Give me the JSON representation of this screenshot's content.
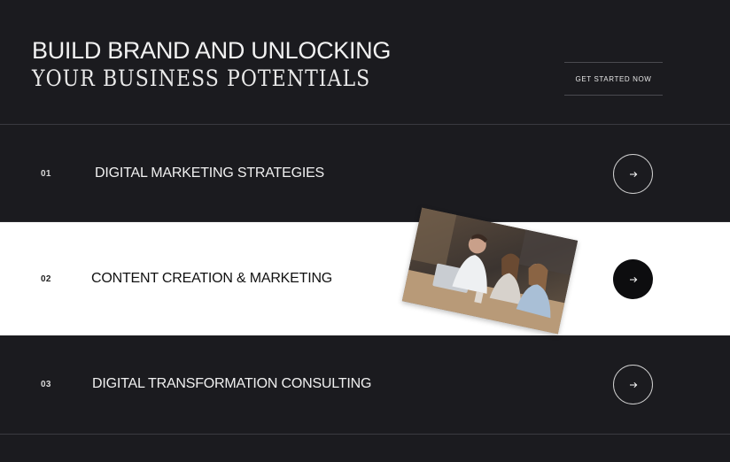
{
  "hero": {
    "title": "BUILD BRAND AND UNLOCKING",
    "subtitle": "YOUR BUSINESS POTENTIALS",
    "cta_label": "GET STARTED NOW"
  },
  "services": [
    {
      "number": "01",
      "label": "DIGITAL MARKETING STRATEGIES",
      "icon": "arrow-right-icon"
    },
    {
      "number": "02",
      "label": "CONTENT CREATION & MARKETING",
      "icon": "arrow-right-icon"
    },
    {
      "number": "03",
      "label": "DIGITAL TRANSFORMATION CONSULTING",
      "icon": "arrow-right-icon"
    }
  ],
  "colors": {
    "background": "#1b1b1f",
    "active_row": "#ffffff",
    "text_light": "#f0f0f0",
    "text_dark": "#111111"
  }
}
